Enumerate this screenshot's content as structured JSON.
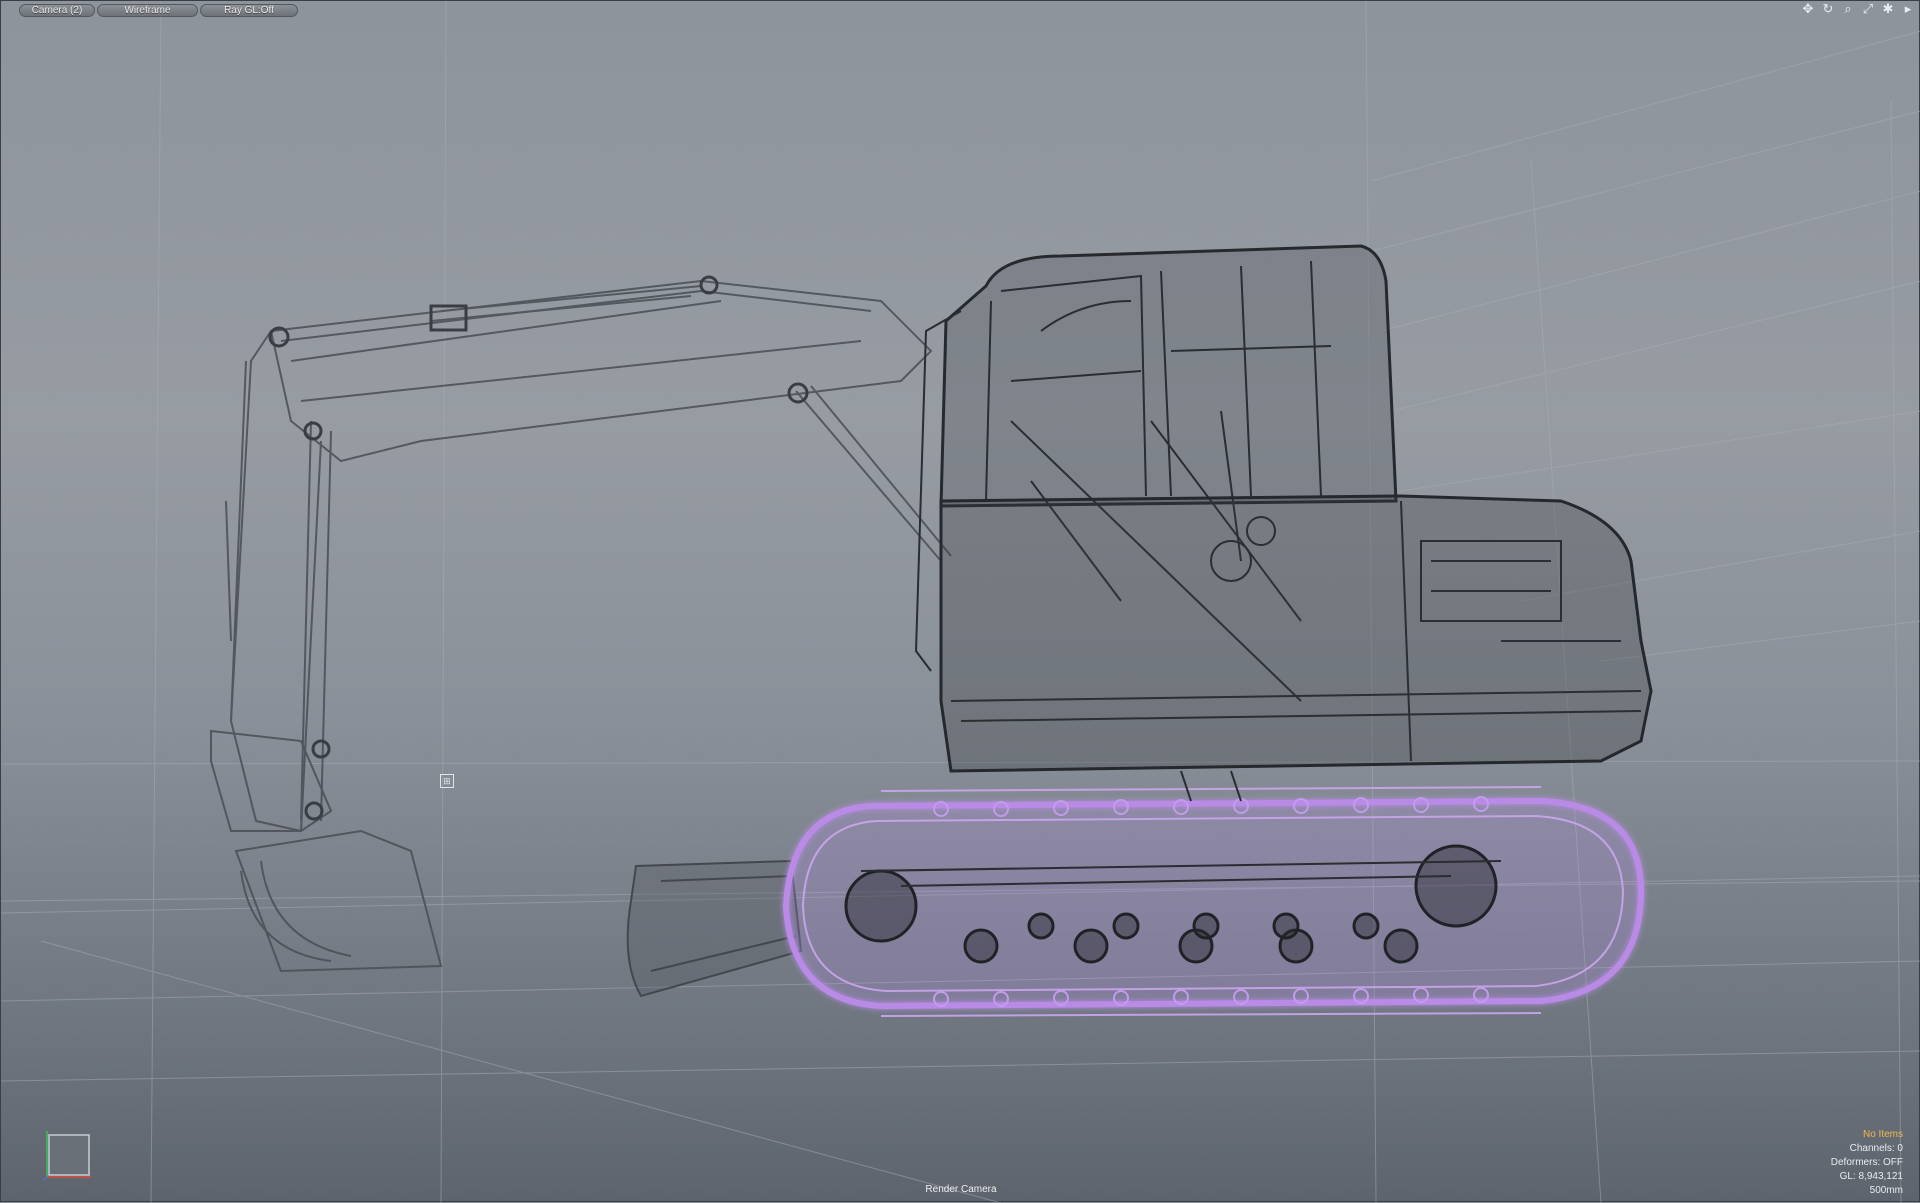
{
  "viewport": {
    "buttons": [
      {
        "id": "camera",
        "label": "Camera (2)"
      },
      {
        "id": "shading",
        "label": "Wireframe"
      },
      {
        "id": "raygl",
        "label": "Ray GL:Off"
      }
    ],
    "nav_icons": [
      "pan-icon",
      "rotate-icon",
      "zoom-icon",
      "fit-icon",
      "settings-icon",
      "expand-arrow-icon"
    ],
    "footer_label": "Render Camera",
    "info": {
      "items": "No Items",
      "channels": "Channels: 0",
      "deformers": "Deformers: OFF",
      "gl": "GL: 8,943,121",
      "grid": "500mm"
    },
    "colors": {
      "selection": "#b98be6",
      "wire": "#2e3135",
      "warning": "#f0b94a"
    }
  }
}
